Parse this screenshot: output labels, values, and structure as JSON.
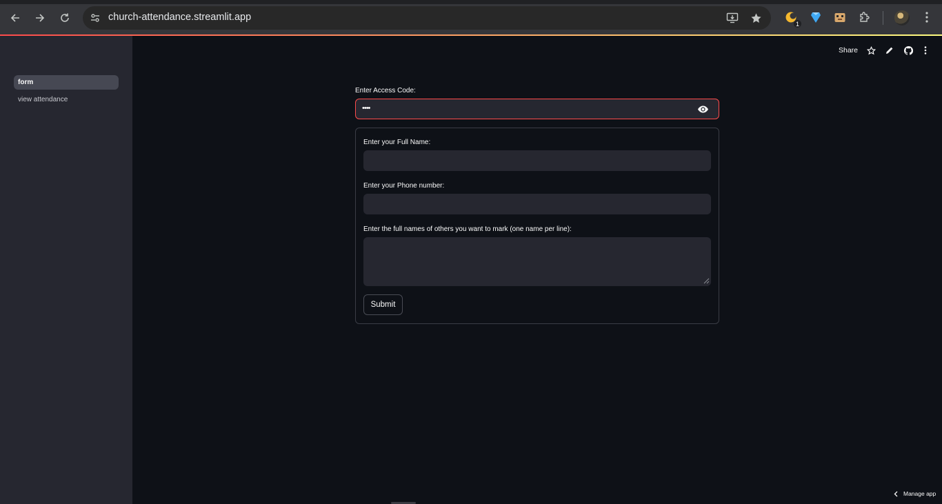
{
  "browser": {
    "url": "church-attendance.streamlit.app",
    "extension_badge": "1"
  },
  "sidebar": {
    "items": [
      {
        "label": "form",
        "active": true
      },
      {
        "label": "view attendance",
        "active": false
      }
    ]
  },
  "header": {
    "share_label": "Share"
  },
  "form": {
    "access_code_label": "Enter Access Code:",
    "access_code_value": "••••",
    "full_name_label": "Enter your Full Name:",
    "full_name_value": "",
    "phone_label": "Enter your Phone number:",
    "phone_value": "",
    "others_label": "Enter the full names of others you want to mark (one name per line):",
    "others_value": "",
    "submit_label": "Submit"
  },
  "footer": {
    "manage_app_label": "Manage app"
  },
  "colors": {
    "background": "#0e1117",
    "sidebar": "#262730",
    "accent_error": "#ff4b4b"
  }
}
